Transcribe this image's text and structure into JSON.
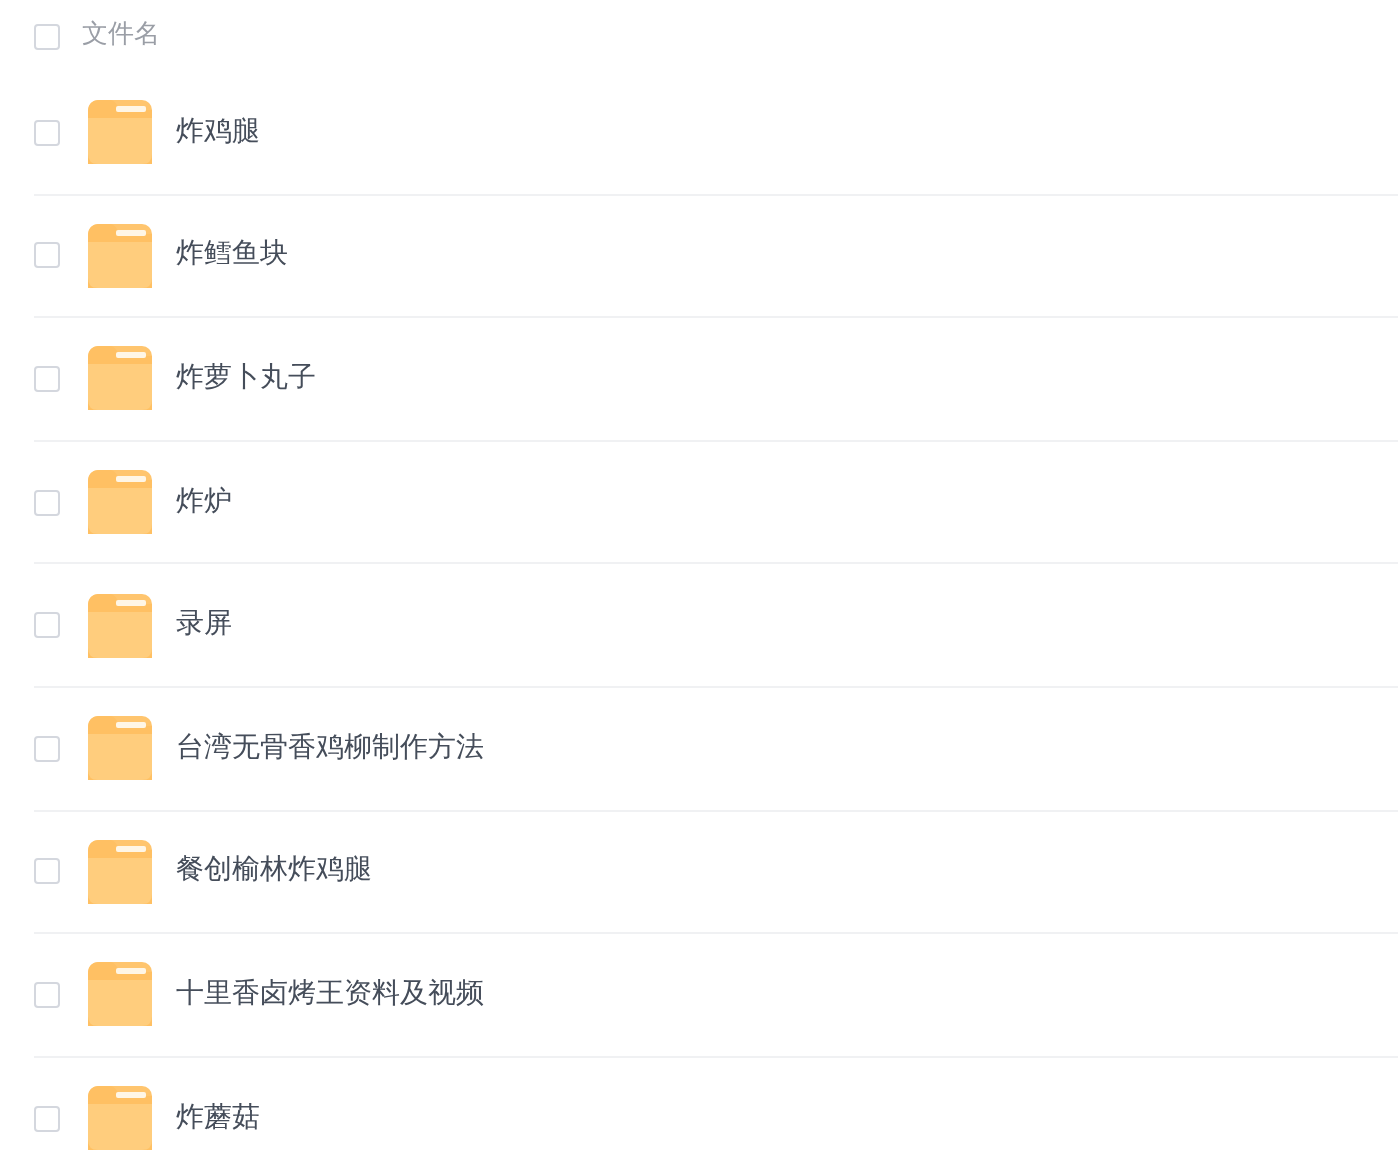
{
  "header": {
    "label": "文件名",
    "checked": false
  },
  "files": [
    {
      "name": "炸鸡腿",
      "selected": false
    },
    {
      "name": "炸鳕鱼块",
      "selected": false
    },
    {
      "name": "炸萝卜丸子",
      "selected": false
    },
    {
      "name": "炸炉",
      "selected": false
    },
    {
      "name": "录屏",
      "selected": false
    },
    {
      "name": "台湾无骨香鸡柳制作方法",
      "selected": false
    },
    {
      "name": "餐创榆林炸鸡腿",
      "selected": false
    },
    {
      "name": "十里香卤烤王资料及视频",
      "selected": false
    },
    {
      "name": "炸蘑菇",
      "selected": false
    }
  ]
}
